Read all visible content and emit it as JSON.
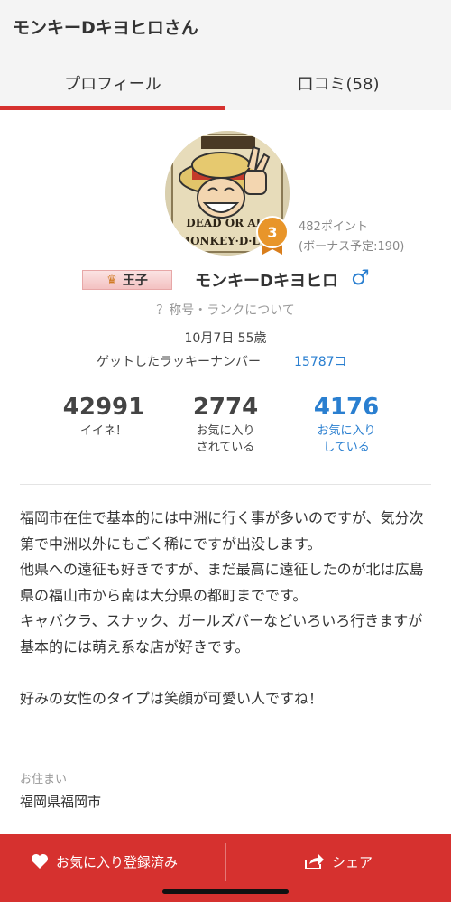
{
  "header": {
    "title": "モンキーDキヨヒロさん",
    "tabs": [
      {
        "label": "プロフィール",
        "active": true
      },
      {
        "label": "口コミ(58)",
        "active": false
      }
    ]
  },
  "profile": {
    "rank_number": "3",
    "points": "482ポイント",
    "bonus": "(ボーナス予定:190)",
    "title_badge": "王子",
    "username": "モンキーDキヨヒロ",
    "gender_symbol": "♂",
    "rank_link": "？称号・ランクについて",
    "birthday": "10月7日 55歳",
    "lucky_label": "ゲットしたラッキーナンバー",
    "lucky_value": "15787コ"
  },
  "stats": [
    {
      "value": "42991",
      "label_line1": "イイネ！",
      "label_line2": ""
    },
    {
      "value": "2774",
      "label_line1": "お気に入り",
      "label_line2": "されている"
    },
    {
      "value": "4176",
      "label_line1": "お気に入り",
      "label_line2": "している"
    }
  ],
  "intro": "福岡市在住で基本的には中洲に行く事が多いのですが、気分次第で中洲以外にもごく稀にですが出没します。\n他県への遠征も好きですが、まだ最高に遠征したのが北は広島県の福山市から南は大分県の都町までです。\nキャバクラ、スナック、ガールズバーなどいろいろ行きますが基本的には萌え系な店が好きです。\n\n好みの女性のタイプは笑顔が可愛い人ですね！",
  "residence": {
    "label": "お住まい",
    "value": "福岡県福岡市"
  },
  "footer": {
    "favorite_label": "お気に入り登録済み",
    "share_label": "シェア"
  },
  "colors": {
    "accent_red": "#d6312f",
    "link_blue": "#2a7fd0",
    "rank_orange": "#e8952a"
  },
  "icons": [
    "heart-icon",
    "share-icon",
    "crown-icon",
    "rank-badge-icon",
    "male-icon"
  ]
}
